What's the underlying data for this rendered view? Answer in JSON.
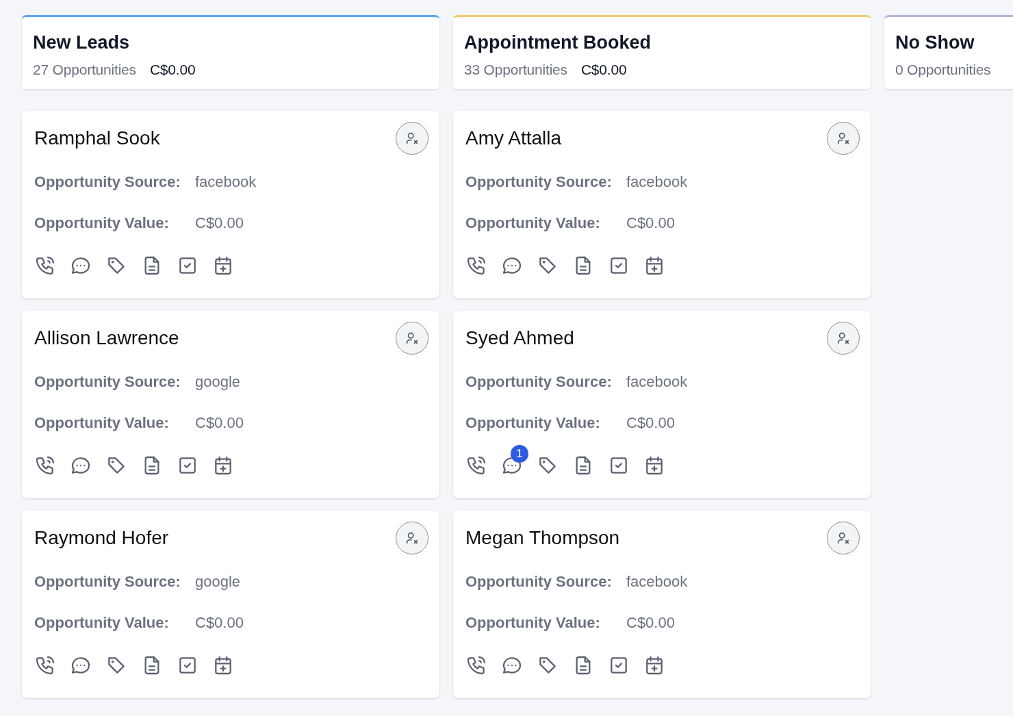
{
  "stages": [
    {
      "title": "New Leads",
      "count": "27 Opportunities",
      "total": "C$0.00",
      "color": "#5aa5ee",
      "cards": [
        {
          "name": "Ramphal Sook",
          "source_label": "Opportunity Source:",
          "source": "facebook",
          "value_label": "Opportunity Value:",
          "value": "C$0.00"
        },
        {
          "name": "Allison Lawrence",
          "source_label": "Opportunity Source:",
          "source": "google",
          "value_label": "Opportunity Value:",
          "value": "C$0.00"
        },
        {
          "name": "Raymond Hofer",
          "source_label": "Opportunity Source:",
          "source": "google",
          "value_label": "Opportunity Value:",
          "value": "C$0.00"
        }
      ]
    },
    {
      "title": "Appointment Booked",
      "count": "33 Opportunities",
      "total": "C$0.00",
      "color": "#f2cb6b",
      "cards": [
        {
          "name": "Amy Attalla",
          "source_label": "Opportunity Source:",
          "source": "facebook",
          "value_label": "Opportunity Value:",
          "value": "C$0.00"
        },
        {
          "name": "Syed Ahmed",
          "source_label": "Opportunity Source:",
          "source": "facebook",
          "value_label": "Opportunity Value:",
          "value": "C$0.00",
          "message_badge": "1"
        },
        {
          "name": "Megan Thompson",
          "source_label": "Opportunity Source:",
          "source": "facebook",
          "value_label": "Opportunity Value:",
          "value": "C$0.00"
        }
      ]
    },
    {
      "title": "No Show",
      "count": "0 Opportunities",
      "color": "#b3b5d9"
    }
  ]
}
